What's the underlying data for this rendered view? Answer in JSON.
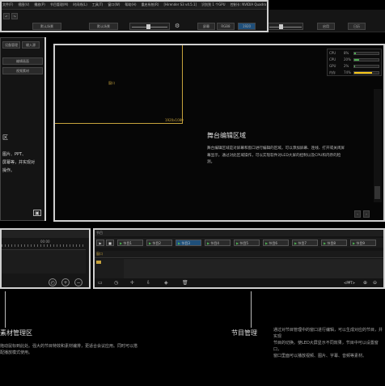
{
  "menu": {
    "items": [
      "文件(F)",
      "视图(V)",
      "播放(P)",
      "节目管理(M)",
      "时间线(L)",
      "工具(T)",
      "窗口(W)",
      "帮助(H)",
      "重启系统(R)",
      "[Hirender S3 v4.5.1]",
      "识别到 1 个GPU",
      "控制卡: NVIDIA Quadro P400",
      "S3.5/4",
      "SDI",
      "D:/Program Files/视拓/Hirender S3/本地.hs3"
    ]
  },
  "toolbar": {
    "fps_label": "默认场景",
    "preset_label": "默认场景",
    "btn_a": "屏幕",
    "btn_b": "RGB8",
    "btn_c": "1920",
    "right_btn1": "启用",
    "right_btn2": "日历"
  },
  "left_panel": {
    "tab1": "设备管理",
    "tab2": "输入源",
    "field1": "编辑画面",
    "field2": "视频素材",
    "text_lines": [
      "区",
      "图片、PPT、",
      "屏幕等，并实现对",
      "操作。"
    ]
  },
  "stage": {
    "window_label": "窗口",
    "screen_label": "1920x1080",
    "title": "舞台编辑区域",
    "description": "舞台编辑区域是对屏幕和窗口进行编辑的区域。可以添加屏幕、连线、打开或关闭屏幕显示，通过对此区域操作，可以实现软件对LED大屏的控制以及CPU和内存的检测。",
    "stats": [
      {
        "name": "CPU",
        "value": "8%",
        "fraction": 0.08,
        "color": "#4caf50"
      },
      {
        "name": "CPU",
        "value": "20%",
        "fraction": 0.2,
        "color": "#4caf50"
      },
      {
        "name": "GPU",
        "value": "2%",
        "fraction": 0.02,
        "color": "#4caf50"
      },
      {
        "name": "内存",
        "value": "74%",
        "fraction": 0.74,
        "color": "#f5c518"
      }
    ],
    "nav_left": "‹",
    "nav_right": "›"
  },
  "timeline": {
    "time_label": "00:00",
    "program_label": "节目",
    "programs": [
      "节目1",
      "节目2",
      "节目3",
      "节目4",
      "节目5",
      "节目6",
      "节目7",
      "节目8",
      "节目9"
    ],
    "layer_label": "窗口",
    "ppt_label": "<PPT>"
  },
  "captions": {
    "left_heading": "素材管理区",
    "left_text": [
      "拖动鼠标到此处。强大的节目特效和素材编排，更适合会议应用。同时可以搭",
      "配播放模式使用。"
    ],
    "right_heading": "节目管理",
    "right_text": [
      "通过对节目管理中的窗口进行编辑，可以生成对应的节目，并实现",
      "节目的切换。使LED大屏显示不同效果，节目中可以设置窗口，",
      "窗口里面可以播放视频、图片、字幕、音频等素材。"
    ]
  }
}
